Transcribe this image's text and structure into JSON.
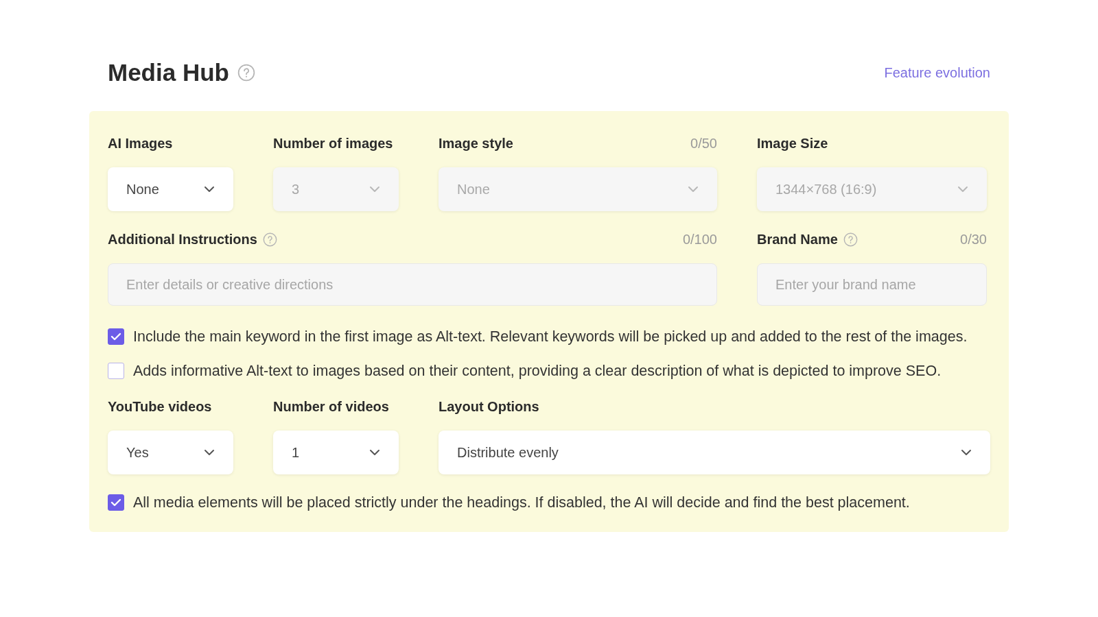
{
  "header": {
    "title": "Media Hub",
    "link": "Feature evolution"
  },
  "image_fields": [
    {
      "kind": "select",
      "label": "AI Images",
      "value": "None",
      "disabled": false
    },
    {
      "kind": "select",
      "label": "Number of images",
      "value": "3",
      "disabled": true
    },
    {
      "kind": "select",
      "label": "Image style",
      "counter": "0/50",
      "value": "None",
      "disabled": true
    },
    {
      "kind": "select",
      "label": "Image Size",
      "value": "1344×768 (16:9)",
      "disabled": true
    }
  ],
  "text_fields": [
    {
      "label": "Additional Instructions",
      "help": true,
      "counter": "0/100",
      "placeholder": "Enter details or creative directions"
    },
    {
      "label": "Brand Name",
      "help": true,
      "counter": "0/30",
      "placeholder": "Enter your brand name"
    }
  ],
  "image_options": [
    {
      "label": "Include the main keyword in the first image as Alt-text. Relevant keywords will be picked up and added to the rest of the images.",
      "checked": true
    },
    {
      "label": "Adds informative Alt-text to images based on their content, providing a clear description of what is depicted to improve SEO.",
      "checked": false
    }
  ],
  "video_fields": [
    {
      "kind": "select",
      "label": "YouTube videos",
      "value": "Yes",
      "disabled": false
    },
    {
      "kind": "select",
      "label": "Number of videos",
      "value": "1",
      "disabled": false
    },
    {
      "kind": "select",
      "label": "Layout Options",
      "value": "Distribute evenly",
      "disabled": false
    }
  ],
  "video_options": [
    {
      "label": "All media elements will be placed strictly under the headings. If disabled, the AI will decide and find the best placement.",
      "checked": true
    }
  ]
}
